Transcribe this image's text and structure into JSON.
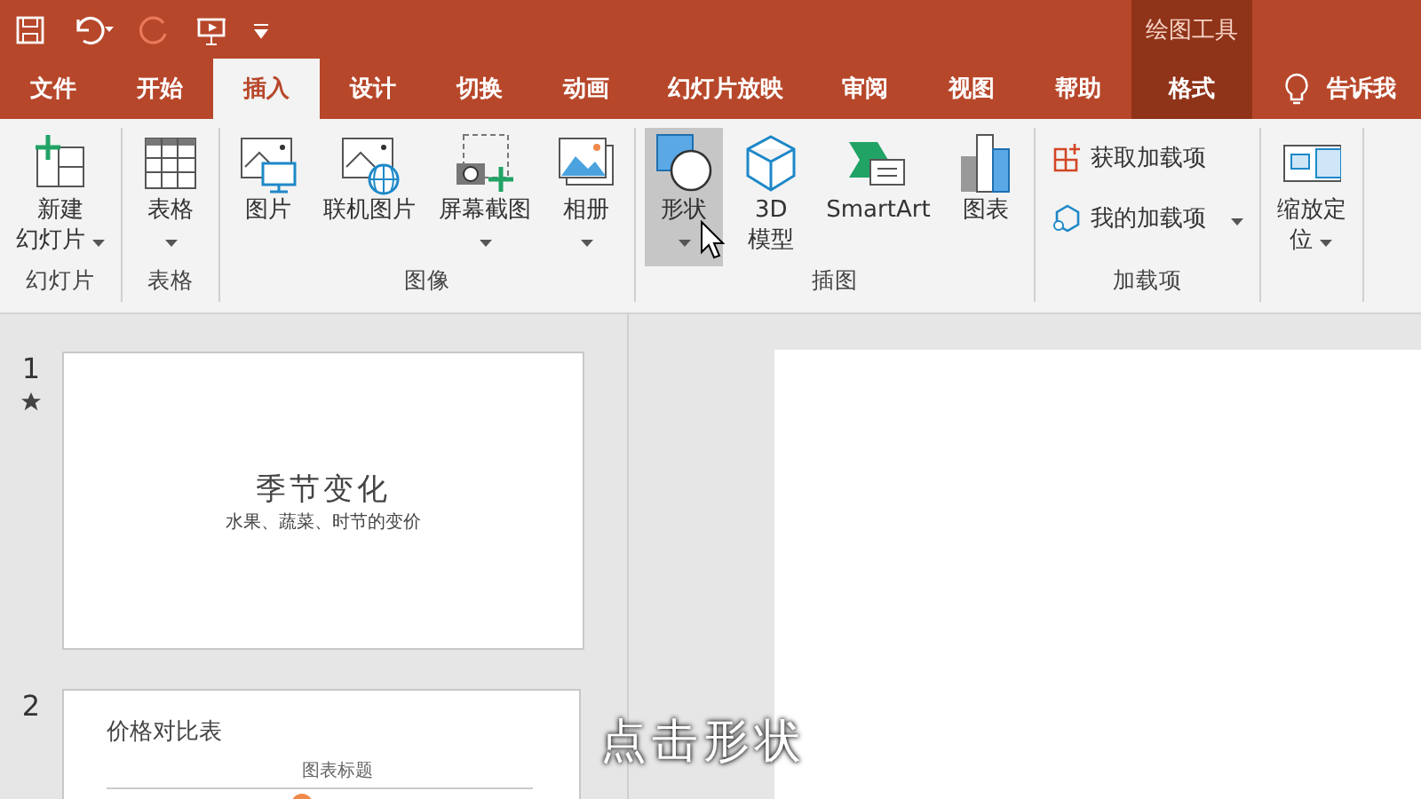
{
  "contextual_header": "绘图工具",
  "tabs": [
    {
      "label": "文件",
      "selected": false,
      "contextual": false
    },
    {
      "label": "开始",
      "selected": false,
      "contextual": false
    },
    {
      "label": "插入",
      "selected": true,
      "contextual": false
    },
    {
      "label": "设计",
      "selected": false,
      "contextual": false
    },
    {
      "label": "切换",
      "selected": false,
      "contextual": false
    },
    {
      "label": "动画",
      "selected": false,
      "contextual": false
    },
    {
      "label": "幻灯片放映",
      "selected": false,
      "contextual": false
    },
    {
      "label": "审阅",
      "selected": false,
      "contextual": false
    },
    {
      "label": "视图",
      "selected": false,
      "contextual": false
    },
    {
      "label": "帮助",
      "selected": false,
      "contextual": false
    },
    {
      "label": "格式",
      "selected": false,
      "contextual": true
    }
  ],
  "tell_me": "告诉我",
  "ribbon_groups": [
    {
      "label": "幻灯片",
      "kind": "large",
      "buttons": [
        {
          "kind": "new-slide",
          "label_lines": [
            "新建",
            "幻灯片"
          ],
          "dropdown": true,
          "highlighted": false
        }
      ]
    },
    {
      "label": "表格",
      "kind": "large",
      "buttons": [
        {
          "kind": "table",
          "label_lines": [
            "表格"
          ],
          "dropdown": true,
          "highlighted": false
        }
      ]
    },
    {
      "label": "图像",
      "kind": "large",
      "buttons": [
        {
          "kind": "picture",
          "label_lines": [
            "图片"
          ],
          "dropdown": false,
          "highlighted": false
        },
        {
          "kind": "online-picture",
          "label_lines": [
            "联机图片"
          ],
          "dropdown": false,
          "highlighted": false
        },
        {
          "kind": "screenshot",
          "label_lines": [
            "屏幕截图"
          ],
          "dropdown": true,
          "highlighted": false
        },
        {
          "kind": "album",
          "label_lines": [
            "相册"
          ],
          "dropdown": true,
          "highlighted": false
        }
      ]
    },
    {
      "label": "插图",
      "kind": "large",
      "buttons": [
        {
          "kind": "shapes",
          "label_lines": [
            "形状"
          ],
          "dropdown": true,
          "highlighted": true
        },
        {
          "kind": "cube",
          "label_lines": [
            "3D",
            "模型"
          ],
          "dropdown": false,
          "highlighted": false
        },
        {
          "kind": "smartart",
          "label_lines": [
            "SmartArt"
          ],
          "dropdown": false,
          "highlighted": false
        },
        {
          "kind": "chart",
          "label_lines": [
            "图表"
          ],
          "dropdown": false,
          "highlighted": false
        }
      ]
    },
    {
      "label": "加载项",
      "kind": "stacked",
      "buttons": [
        {
          "kind": "get-addins",
          "label_lines": [
            "获取加载项"
          ],
          "dropdown": false,
          "highlighted": false
        },
        {
          "kind": "my-addins",
          "label_lines": [
            "我的加载项"
          ],
          "dropdown": true,
          "highlighted": false
        }
      ]
    },
    {
      "kind": "large",
      "buttons": [
        {
          "kind": "zoom",
          "label_lines": [
            "缩放定",
            "位"
          ],
          "dropdown": true,
          "highlighted": false
        }
      ]
    }
  ],
  "slides": [
    {
      "number": "1",
      "starred": true,
      "title": "季节变化",
      "subtitle": "水果、蔬菜、时节的变价"
    },
    {
      "number": "2",
      "starred": false,
      "title": "价格对比表",
      "chart_caption": "图表标题"
    }
  ],
  "caption": "点击形状"
}
